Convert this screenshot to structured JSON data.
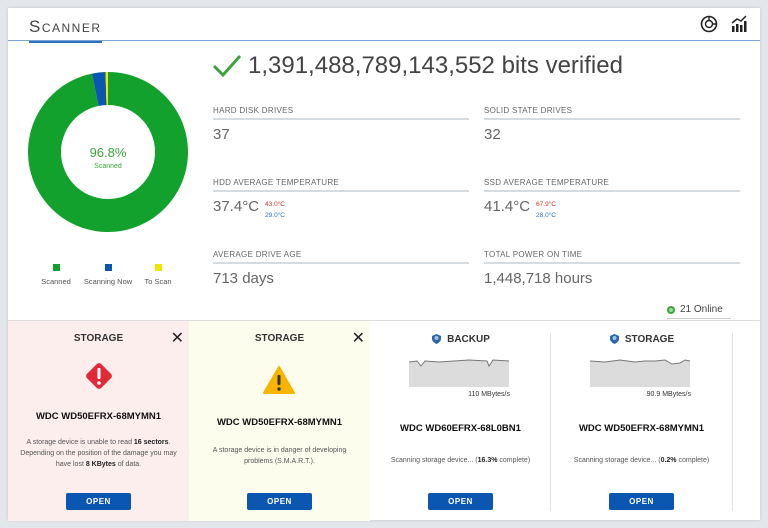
{
  "header": {
    "title": "Scanner",
    "icons": [
      "dashboard-gauge-icon",
      "statistics-chart-icon"
    ]
  },
  "summary": {
    "bits_verified": "1,391,488,789,143,552 bits verified"
  },
  "donut": {
    "center_value": "96.8%",
    "center_label": "Scanned",
    "segments": [
      {
        "label": "Scanned",
        "percent": 96.8,
        "color": "#12a12c"
      },
      {
        "label": "Scanning Now",
        "percent": 2.7,
        "color": "#0a56b0"
      },
      {
        "label": "To Scan",
        "percent": 0.5,
        "color": "#f2e600"
      }
    ]
  },
  "stats": {
    "hdd": {
      "label": "HARD DISK DRIVES",
      "value": "37"
    },
    "ssd": {
      "label": "SOLID STATE DRIVES",
      "value": "32"
    },
    "hdd_temp": {
      "label": "HDD AVERAGE TEMPERATURE",
      "value": "37.4°C",
      "max": "43.0°C",
      "min": "29.0°C"
    },
    "ssd_temp": {
      "label": "SSD AVERAGE TEMPERATURE",
      "value": "41.4°C",
      "max": "67.9°C",
      "min": "28.0°C"
    },
    "age": {
      "label": "AVERAGE DRIVE AGE",
      "value": "713 days"
    },
    "power": {
      "label": "TOTAL POWER ON TIME",
      "value": "1,448,718 hours"
    }
  },
  "online": "21 Online",
  "cards": [
    {
      "title": "STORAGE",
      "model": "WDC WD50EFRX-68MYMN1",
      "msg1": "A storage device is unable to read ",
      "b1": "16 sectors",
      "msg2": ". Depending on the position of the damage you may have lost ",
      "b2": "8 KBytes",
      "msg3": " of data.",
      "button": "OPEN"
    },
    {
      "title": "STORAGE",
      "model": "WDC WD50EFRX-68MYMN1",
      "msg": "A storage device is in danger of developing problems (S.M.A.R.T.).",
      "button": "OPEN"
    },
    {
      "title": "BACKUP",
      "speed": "110 MBytes/s",
      "model": "WDC WD60EFRX-68L0BN1",
      "msg1": "Scanning storage device... (",
      "pct": "16.3%",
      "msg2": " complete)",
      "button": "OPEN"
    },
    {
      "title": "STORAGE",
      "speed": "90.9 MBytes/s",
      "model": "WDC WD50EFRX-68MYMN1",
      "msg1": "Scanning storage device... (",
      "pct": "0.2%",
      "msg2": " complete)",
      "button": "OPEN"
    }
  ]
}
